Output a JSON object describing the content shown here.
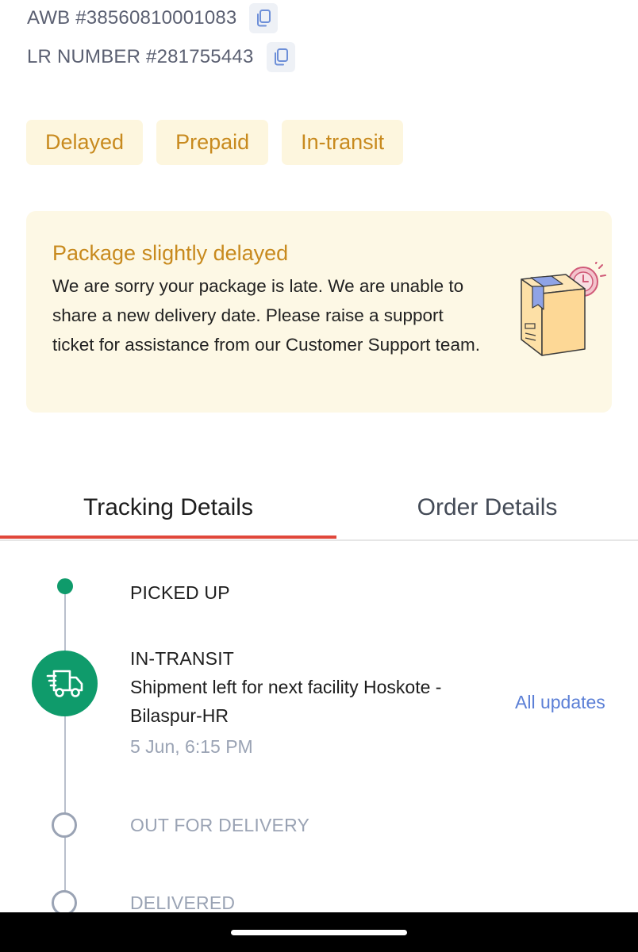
{
  "shipment": {
    "awb_text": "AWB #38560810001083",
    "lr_text": "LR NUMBER #281755443"
  },
  "badges": [
    "Delayed",
    "Prepaid",
    "In-transit"
  ],
  "alert": {
    "title": "Package slightly delayed",
    "body": "We are sorry your package is late. We are unable to share a new delivery date. Please raise a support ticket for assistance from our Customer Support team.",
    "illustration_icon": "delayed-package-icon"
  },
  "tabs": {
    "tracking": "Tracking Details",
    "order": "Order Details",
    "active": "tracking"
  },
  "timeline": {
    "picked_up": "PICKED UP",
    "in_transit": {
      "label": "IN-TRANSIT",
      "description": "Shipment left for next facility Hoskote - Bilaspur-HR",
      "time": "5 Jun, 6:15 PM",
      "icon": "truck-icon"
    },
    "out_for_delivery": "OUT FOR DELIVERY",
    "delivered": "DELIVERED",
    "all_updates_link": "All updates"
  },
  "colors": {
    "accent_green": "#0f9b6b",
    "badge_text": "#c88a1e",
    "badge_bg": "#fdf6de",
    "alert_bg": "#fdf8e5",
    "tab_indicator": "#e0473b",
    "link_blue": "#5b7fd6",
    "muted_gray": "#9aa3b4"
  }
}
